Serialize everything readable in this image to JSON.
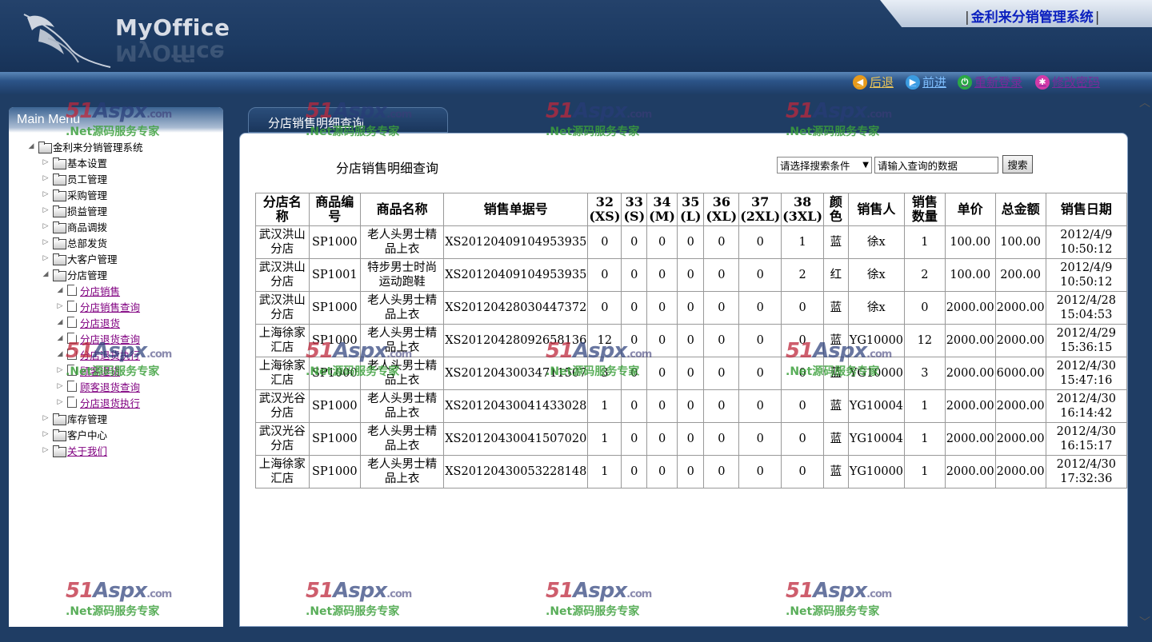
{
  "header": {
    "logo_text": "MyOffice",
    "system_title": "金利来分销管理系统"
  },
  "toolbar": {
    "back": "后退",
    "forward": "前进",
    "relogin": "重新登录",
    "change_password": "修改密码"
  },
  "sidebar": {
    "title": "Main Menu",
    "root": "金利来分销管理系统",
    "items": [
      {
        "label": "基本设置"
      },
      {
        "label": "员工管理"
      },
      {
        "label": "采购管理"
      },
      {
        "label": "损益管理"
      },
      {
        "label": "商品调拨"
      },
      {
        "label": "总部发货"
      },
      {
        "label": "大客户管理"
      },
      {
        "label": "分店管理"
      },
      {
        "label": "分店销售"
      },
      {
        "label": "分店销售查询"
      },
      {
        "label": "分店退货"
      },
      {
        "label": "分店退货查询"
      },
      {
        "label": "分店退货执行"
      },
      {
        "label": "顾客退货"
      },
      {
        "label": "顾客退货查询"
      },
      {
        "label": "分店退货执行"
      },
      {
        "label": "库存管理"
      },
      {
        "label": "客户中心"
      },
      {
        "label": "关于我们"
      }
    ]
  },
  "main": {
    "tab_label": "分店销售明细查询",
    "title": "分店销售明细查询",
    "search_select": "请选择搜索条件",
    "search_input": "请输入查询的数据",
    "search_button": "搜索"
  },
  "table": {
    "headers": [
      "分店名称",
      "商品编号",
      "商品名称",
      "销售单据号",
      "32 (XS)",
      "33 (S)",
      "34 (M)",
      "35 (L)",
      "36 (XL)",
      "37 (2XL)",
      "38 (3XL)",
      "颜色",
      "销售人",
      "销售数量",
      "单价",
      "总金额",
      "销售日期"
    ],
    "rows": [
      [
        "武汉洪山分店",
        "SP1000",
        "老人头男士精品上衣",
        "XS20120409104953935",
        "0",
        "0",
        "0",
        "0",
        "0",
        "0",
        "1",
        "蓝",
        "徐x",
        "1",
        "100.00",
        "100.00",
        "2012/4/9 10:50:12"
      ],
      [
        "武汉洪山分店",
        "SP1001",
        "特步男士时尚运动跑鞋",
        "XS20120409104953935",
        "0",
        "0",
        "0",
        "0",
        "0",
        "0",
        "2",
        "红",
        "徐x",
        "2",
        "100.00",
        "200.00",
        "2012/4/9 10:50:12"
      ],
      [
        "武汉洪山分店",
        "SP1000",
        "老人头男士精品上衣",
        "XS20120428030447372",
        "0",
        "0",
        "0",
        "0",
        "0",
        "0",
        "0",
        "蓝",
        "徐x",
        "0",
        "2000.00",
        "2000.00",
        "2012/4/28 15:04:53"
      ],
      [
        "上海徐家汇店",
        "SP1000",
        "老人头男士精品上衣",
        "XS20120428092658136",
        "12",
        "0",
        "0",
        "0",
        "0",
        "0",
        "0",
        "蓝",
        "YG10000",
        "12",
        "2000.00",
        "2000.00",
        "2012/4/29 15:36:15"
      ],
      [
        "上海徐家汇店",
        "SP1000",
        "老人头男士精品上衣",
        "XS20120430034711507",
        "3",
        "0",
        "0",
        "0",
        "0",
        "0",
        "0",
        "蓝",
        "YG10000",
        "3",
        "2000.00",
        "6000.00",
        "2012/4/30 15:47:16"
      ],
      [
        "武汉光谷分店",
        "SP1000",
        "老人头男士精品上衣",
        "XS20120430041433028",
        "1",
        "0",
        "0",
        "0",
        "0",
        "0",
        "0",
        "蓝",
        "YG10004",
        "1",
        "2000.00",
        "2000.00",
        "2012/4/30 16:14:42"
      ],
      [
        "武汉光谷分店",
        "SP1000",
        "老人头男士精品上衣",
        "XS20120430041507020",
        "1",
        "0",
        "0",
        "0",
        "0",
        "0",
        "0",
        "蓝",
        "YG10004",
        "1",
        "2000.00",
        "2000.00",
        "2012/4/30 16:15:17"
      ],
      [
        "上海徐家汇店",
        "SP1000",
        "老人头男士精品上衣",
        "XS20120430053228148",
        "1",
        "0",
        "0",
        "0",
        "0",
        "0",
        "0",
        "蓝",
        "YG10000",
        "1",
        "2000.00",
        "2000.00",
        "2012/4/30 17:32:36"
      ]
    ]
  },
  "watermark": {
    "brand_num": "51",
    "brand_text": "Aspx",
    "brand_domain": ".com",
    "slogan": ".Net源码服务专家"
  },
  "colors": {
    "header_bg": "#1c3a62",
    "system_title": "#0a1fbf",
    "link_visited": "#800080",
    "watermark_green": "#3ca03c"
  }
}
